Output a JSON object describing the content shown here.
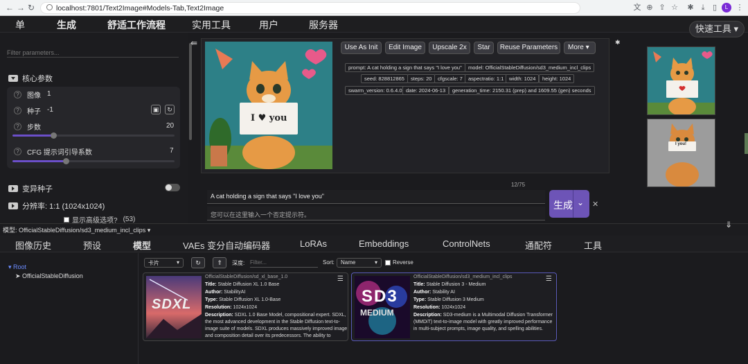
{
  "browser": {
    "url": "localhost:7801/Text2Image#Models-Tab,Text2Image",
    "profile_initial": "L"
  },
  "top_tabs": [
    "单",
    "生成",
    "舒适工作流程",
    "实用工具",
    "用户",
    "服务器"
  ],
  "quick_tools": "快速工具",
  "left": {
    "filter_placeholder": "Filter parameters...",
    "core_group": "核心参数",
    "params": [
      {
        "label": "图像",
        "value": "1"
      },
      {
        "label": "种子",
        "value": "-1"
      },
      {
        "label": "步数",
        "value": "20",
        "fraction": 0.25
      },
      {
        "label": "CFG 提示词引导系数",
        "value": "7",
        "fraction": 0.33
      }
    ],
    "variation_seed": "变异种子",
    "resolution": "分辨率: 1:1 (1024x1024)",
    "advanced_label": "显示高级选项?",
    "advanced_count": "(53)"
  },
  "actions": [
    "Use As Init",
    "Edit Image",
    "Upscale 2x",
    "Star",
    "Reuse Parameters",
    "More"
  ],
  "metadata": [
    "prompt: A cat holding a sign that says \"I love you\"",
    "model: OfficialStableDiffusion/sd3_medium_incl_clips",
    "seed: 828812865",
    "steps: 20",
    "cfgscale: 7",
    "aspectratio: 1:1",
    "width: 1024",
    "height: 1024",
    "swarm_version: 0.6.4.0",
    "date: 2024-06-13",
    "generation_time: 2150.31 (prep) and 1609.55 (gen) seconds"
  ],
  "sign_text": "I ♥ you",
  "sign_text_2": "I you!",
  "prompt": {
    "counter": "12/75",
    "text": "A cat holding a sign that says \"I love you\"",
    "negative_placeholder": "您可以在这里输入一个否定提示符。",
    "generate_label": "生成"
  },
  "model_bar": {
    "label": "模型: ",
    "value": "OfficialStableDiffusion/sd3_medium_incl_clips"
  },
  "sub_tabs": [
    "图像历史",
    "预设",
    "模型",
    "VAEs 变分自动编码器",
    "LoRAs",
    "Embeddings",
    "ControlNets",
    "通配符",
    "工具"
  ],
  "tree": {
    "root": "Root",
    "child": "OfficialStableDiffusion"
  },
  "toolbar": {
    "view": "卡片",
    "depth_label": "深度:",
    "filter_placeholder": "Filter...",
    "sort_label": "Sort:",
    "sort_value": "Name",
    "reverse_label": "Reverse"
  },
  "cards": [
    {
      "path": "OfficialStableDiffusion/sd_xl_base_1.0",
      "title": "Stable Diffusion XL 1.0 Base",
      "author": "StabilityAI",
      "type": "Stable Diffusion XL 1.0-Base",
      "resolution": "1024x1024",
      "description": "SDXL 1.0 Base Model, compositional expert. SDXL, the most advanced development in the Stable Diffusion text-to-image suite of models. SDXL produces massively improved image and composition detail over its predecessors. The ability to",
      "logo": "SDXL"
    },
    {
      "path": "OfficialStableDiffusion/sd3_medium_incl_clips",
      "title": "Stable Diffusion 3 - Medium",
      "author": "Stability AI",
      "type": "Stable Diffusion 3 Medium",
      "resolution": "1024x1024",
      "description": "SD3-medium is a Multimodal Diffusion Transformer (MMDiT) text-to-image model with greatly improved performance in multi-subject prompts, image quality, and spelling abilities.",
      "logo": "SD3",
      "logo_sub": "MEDIUM"
    }
  ],
  "card_labels": {
    "title": "Title: ",
    "author": "Author: ",
    "type": "Type: ",
    "resolution": "Resolution: ",
    "description": "Description: "
  },
  "colors": {
    "accent": "#6d54b7",
    "background": "#1b1b1e",
    "panel": "#26262a"
  }
}
